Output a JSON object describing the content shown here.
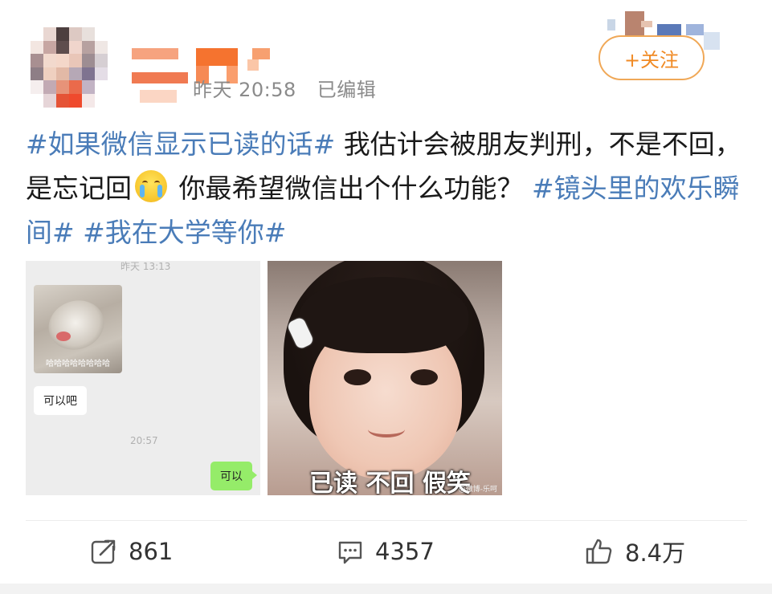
{
  "post": {
    "timestamp": "昨天 20:58",
    "edited_label": "已编辑",
    "follow_label": "+关注",
    "text": {
      "tag1": "#如果微信显示已读的话#",
      "body1": " 我估计会被朋友判刑，不是不回，是忘记回",
      "body2": " 你最希望微信出个什么功能？",
      "tag2": "#镜头里的欢乐瞬间#",
      "tag3": "#我在大学等你#"
    }
  },
  "images": {
    "chat": {
      "time_top": "昨天 13:13",
      "sticker_caption": "哈哈哈哈哈哈哈哈",
      "bubble_left": "可以吧",
      "time_mid": "20:57",
      "bubble_right": "可以"
    },
    "photo": {
      "caption": "已读 不回 假笑",
      "watermark": "@微博-乐呵"
    }
  },
  "actions": {
    "repost_count": "861",
    "comment_count": "4357",
    "like_count": "8.4万"
  },
  "colors": {
    "hashtag": "#4a7cb8",
    "follow": "#f08a24",
    "chat_bubble_green": "#95ec69"
  }
}
